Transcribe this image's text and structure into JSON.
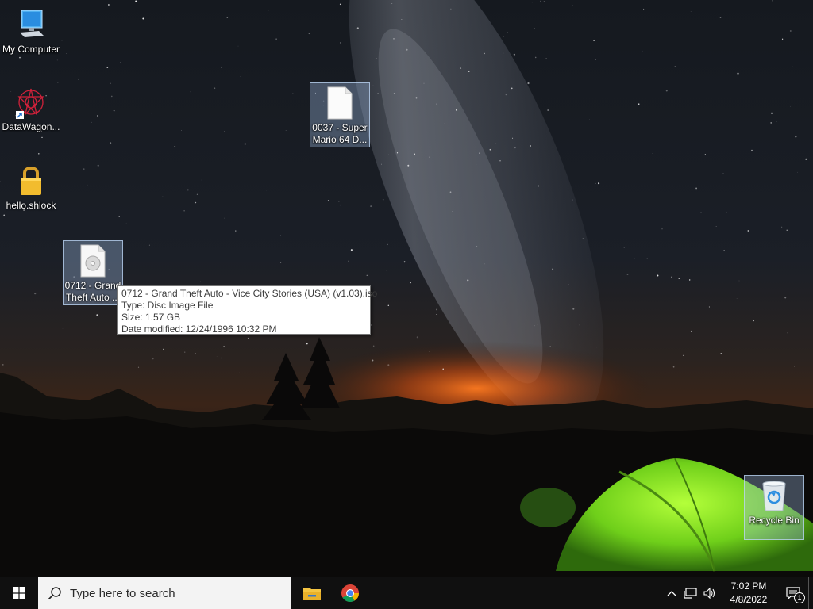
{
  "desktop": {
    "icons": [
      {
        "label": "My Computer",
        "icon": "computer-icon"
      },
      {
        "label": "DataWagon...",
        "icon": "datawagon-icon"
      },
      {
        "label": "hello.shlock",
        "icon": "lock-icon"
      },
      {
        "label": "0712 - Grand Theft Auto ...",
        "icon": "disc-image-file-icon",
        "selected": true
      },
      {
        "label": "0037 - Super Mario 64 D...",
        "icon": "blank-file-icon",
        "selected": true
      },
      {
        "label": "Recycle Bin",
        "icon": "recycle-bin-icon",
        "selected": true
      }
    ]
  },
  "tooltip": {
    "name": "0712 - Grand Theft Auto - Vice City Stories (USA) (v1.03).iso",
    "type": "Type: Disc Image File",
    "size": "Size: 1.57 GB",
    "modified": "Date modified: 12/24/1996 10:32 PM"
  },
  "taskbar": {
    "search_placeholder": "Type here to search",
    "apps": [
      "file-explorer-icon",
      "chrome-icon"
    ],
    "clock": {
      "time": "7:02 PM",
      "date": "4/8/2022"
    },
    "notification_count": "1"
  },
  "colors": {
    "taskbar": "#101010",
    "search_box": "#f3f3f3",
    "selection": "#a0bee6"
  }
}
